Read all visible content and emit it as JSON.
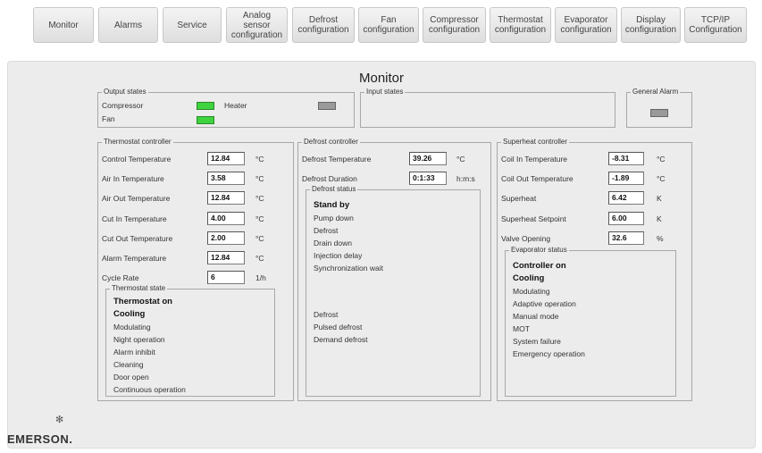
{
  "tabs": [
    {
      "label": "Monitor"
    },
    {
      "label": "Alarms"
    },
    {
      "label": "Service"
    },
    {
      "label": "Analog\nsensor\nconfiguration"
    },
    {
      "label": "Defrost\nconfiguration"
    },
    {
      "label": "Fan\nconfiguration"
    },
    {
      "label": "Compressor\nconfiguration"
    },
    {
      "label": "Thermostat\nconfiguration"
    },
    {
      "label": "Evaporator\nconfiguration"
    },
    {
      "label": "Display\nconfiguration"
    },
    {
      "label": "TCP/IP\nConfiguration"
    }
  ],
  "page_title": "Monitor",
  "output_states": {
    "label": "Output states",
    "compressor": "Compressor",
    "fan": "Fan",
    "heater": "Heater"
  },
  "input_states": {
    "label": "Input states"
  },
  "general_alarm": {
    "label": "General Alarm"
  },
  "thermostat_controller": {
    "label": "Thermostat controller",
    "rows": [
      {
        "label": "Control Temperature",
        "value": "12.84",
        "unit": "°C"
      },
      {
        "label": "Air In Temperature",
        "value": "3.58",
        "unit": "°C"
      },
      {
        "label": "Air Out Temperature",
        "value": "12.84",
        "unit": "°C"
      },
      {
        "label": "Cut In Temperature",
        "value": "4.00",
        "unit": "°C"
      },
      {
        "label": "Cut Out Temperature",
        "value": "2.00",
        "unit": "°C"
      },
      {
        "label": "Alarm Temperature",
        "value": "12.84",
        "unit": "°C"
      },
      {
        "label": "Cycle Rate",
        "value": "6",
        "unit": "1/h"
      }
    ],
    "state": {
      "label": "Thermostat state",
      "items": [
        "Thermostat on",
        "Cooling",
        "Modulating",
        "Night operation",
        "Alarm inhibit",
        "Cleaning",
        "Door open",
        "Continuous operation"
      ]
    }
  },
  "defrost_controller": {
    "label": "Defrost controller",
    "rows": [
      {
        "label": "Defrost Temperature",
        "value": "39.26",
        "unit": "°C"
      },
      {
        "label": "Defrost Duration",
        "value": "0:1:33",
        "unit": "h:m:s"
      }
    ],
    "status": {
      "label": "Defrost status",
      "items_top": [
        "Stand by",
        "Pump down",
        "Defrost",
        "Drain down",
        "Injection delay",
        "Synchronization wait"
      ],
      "items_bottom": [
        "Defrost",
        "Pulsed defrost",
        "Demand defrost"
      ]
    }
  },
  "superheat_controller": {
    "label": "Superheat controller",
    "rows": [
      {
        "label": "Coil In Temperature",
        "value": "-8.31",
        "unit": "°C"
      },
      {
        "label": "Coil Out Temperature",
        "value": "-1.89",
        "unit": "°C"
      },
      {
        "label": "Superheat",
        "value": "6.42",
        "unit": "K"
      },
      {
        "label": "Superheat Setpoint",
        "value": "6.00",
        "unit": "K"
      },
      {
        "label": "Valve Opening",
        "value": "32.6",
        "unit": "%"
      }
    ],
    "status": {
      "label": "Evaporator status",
      "items": [
        "Controller on",
        "Cooling",
        "Modulating",
        "Adaptive operation",
        "Manual mode",
        "MOT",
        "System failure",
        "Emergency operation"
      ]
    }
  },
  "brand": {
    "name": "EMERSON."
  },
  "colors": {
    "led_on": "#3fd33f",
    "led_off": "#9a9a9a",
    "panel": "#ececec"
  }
}
